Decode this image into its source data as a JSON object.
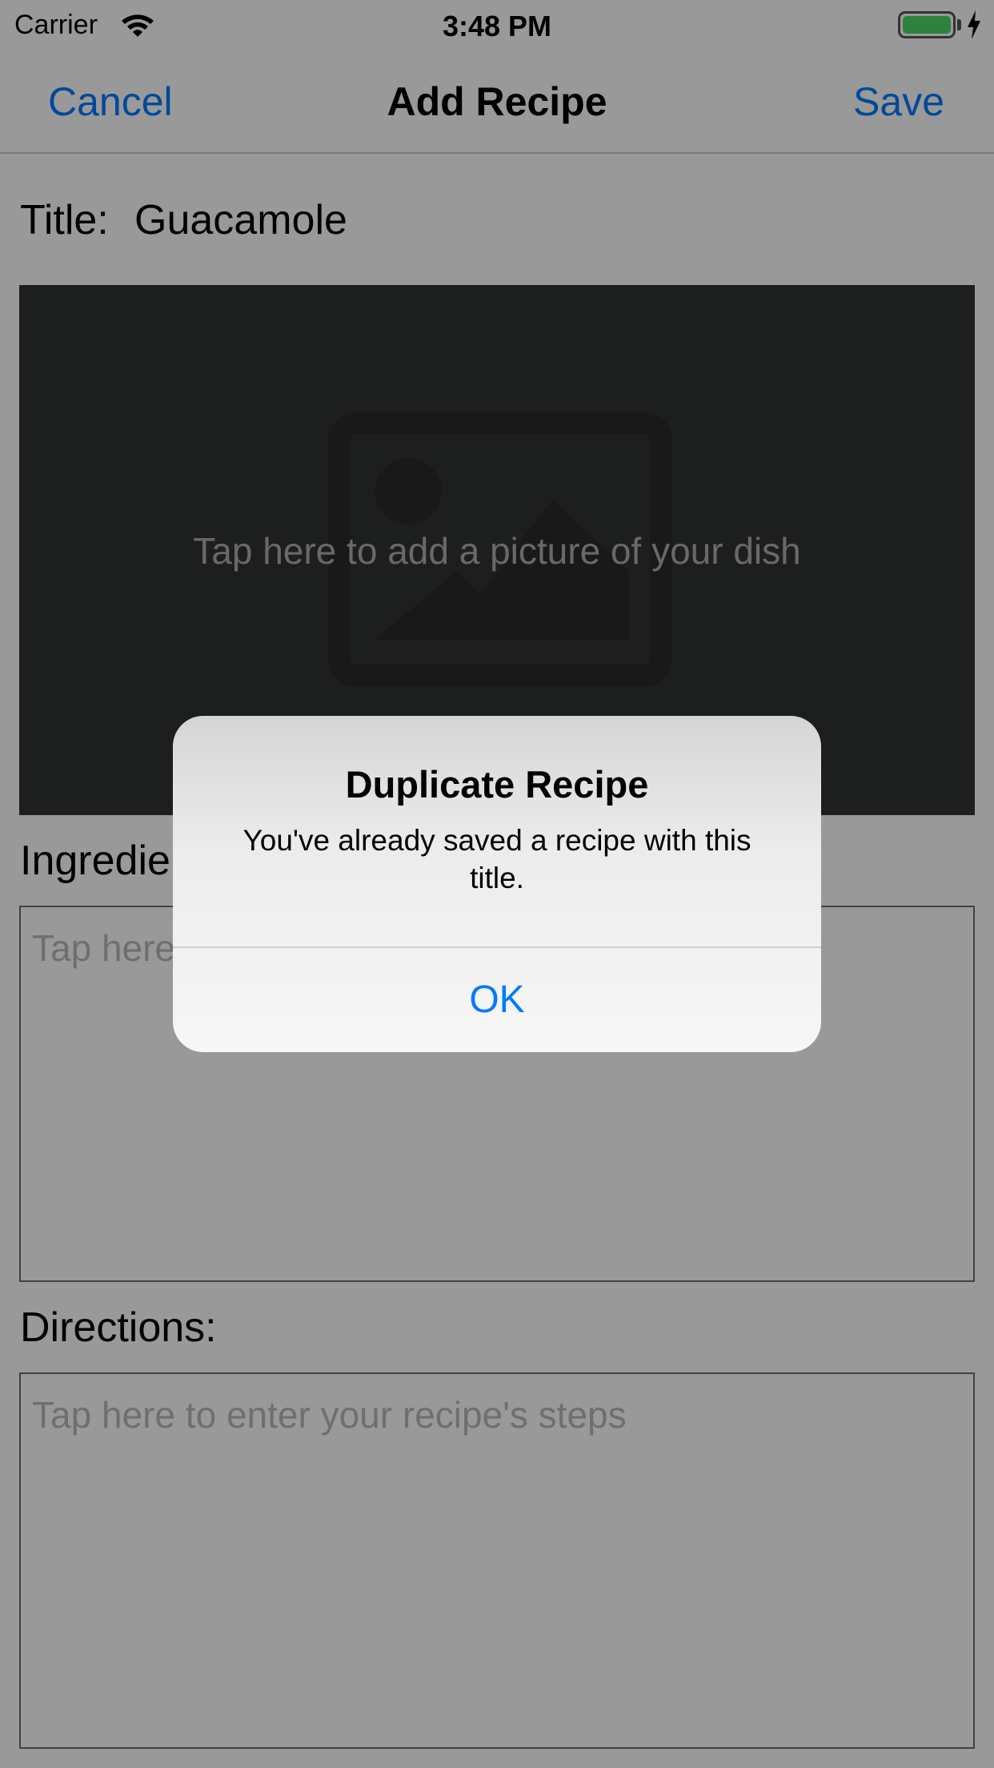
{
  "status_bar": {
    "carrier": "Carrier",
    "time": "3:48 PM",
    "battery_color": "#4cd964"
  },
  "nav": {
    "cancel_label": "Cancel",
    "title": "Add Recipe",
    "save_label": "Save",
    "tint_color": "#007aff"
  },
  "form": {
    "title_label": "Title:",
    "title_value": "Guacamole",
    "image_hint": "Tap here to add a picture of your dish",
    "image_icon": "photo-placeholder-icon",
    "ingredients_label": "Ingredients:",
    "ingredients_placeholder": "Tap here to enter your recipe's ingredients",
    "directions_label": "Directions:",
    "directions_placeholder": "Tap here to enter your recipe's steps"
  },
  "alert": {
    "title": "Duplicate Recipe",
    "message": "You've already saved a recipe with this title.",
    "ok_label": "OK"
  }
}
